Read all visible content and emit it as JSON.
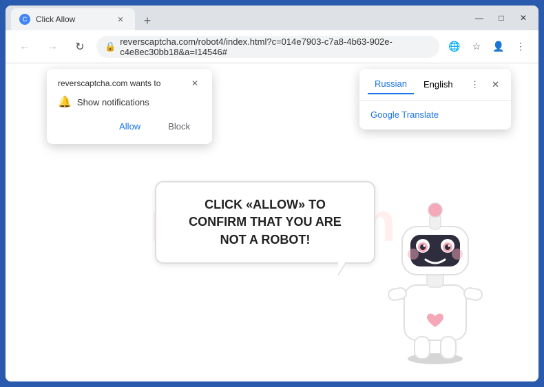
{
  "browser": {
    "title": "Click Allow",
    "tab": {
      "label": "Click Allow",
      "favicon": "C"
    },
    "url": "reverscaptcha.com/robot4/index.html?c=014e7903-c7a8-4b63-902e-c4e8ec30bb18&a=I14546#",
    "nav": {
      "back": "←",
      "forward": "→",
      "refresh": "↻",
      "lock": "🔒"
    }
  },
  "window_controls": {
    "minimize": "—",
    "maximize": "□",
    "close": "✕"
  },
  "notification_popup": {
    "title": "reverscaptcha.com wants to",
    "close": "✕",
    "notification_label": "Show notifications",
    "allow_btn": "Allow",
    "block_btn": "Block"
  },
  "translate_popup": {
    "lang_russian": "Russian",
    "lang_english": "English",
    "service": "Google Translate"
  },
  "page": {
    "bubble_text": "CLICK «ALLOW» TO CONFIRM THAT YOU ARE NOT A ROBOT!",
    "watermark": "risk4.com"
  }
}
